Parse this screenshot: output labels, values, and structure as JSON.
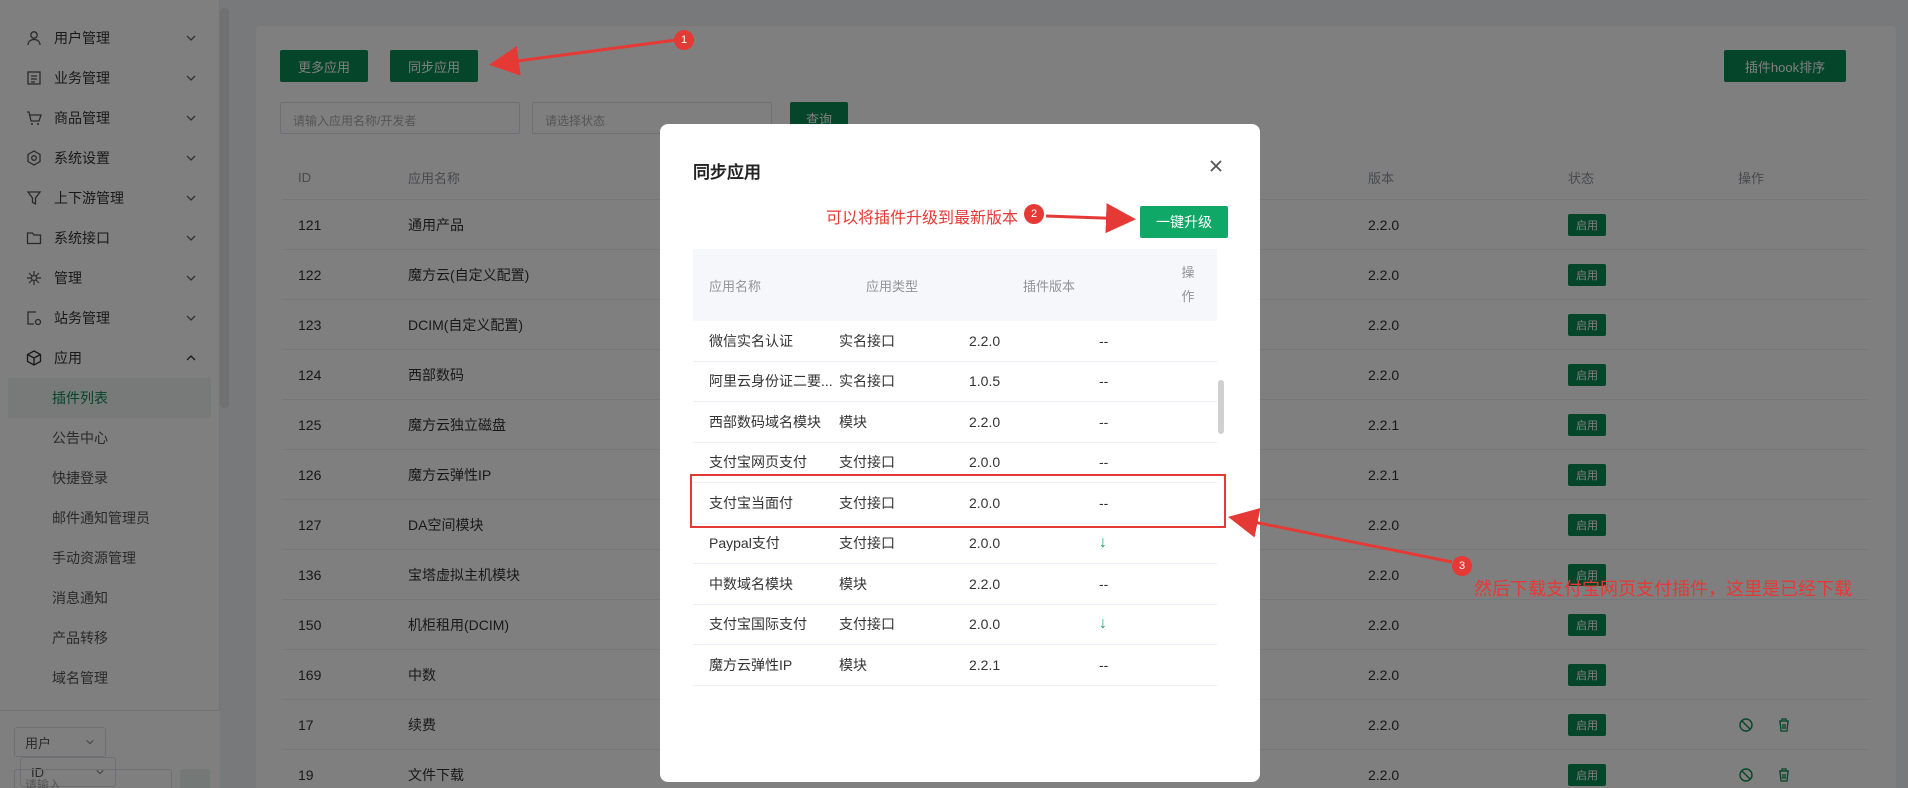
{
  "sidebar": {
    "menu_top": [
      {
        "label": "用户管理",
        "icon": "user-icon"
      },
      {
        "label": "业务管理",
        "icon": "list-icon"
      },
      {
        "label": "商品管理",
        "icon": "cart-icon"
      },
      {
        "label": "系统设置",
        "icon": "gear-icon"
      },
      {
        "label": "上下游管理",
        "icon": "filter-icon"
      },
      {
        "label": "系统接口",
        "icon": "folder-icon"
      },
      {
        "label": "管理",
        "icon": "sparkle-icon"
      },
      {
        "label": "站务管理",
        "icon": "station-icon"
      },
      {
        "label": "应用",
        "icon": "cube-icon"
      }
    ],
    "sub_items": [
      "插件列表",
      "公告中心",
      "快捷登录",
      "邮件通知管理员",
      "手动资源管理",
      "消息通知",
      "产品转移",
      "域名管理"
    ],
    "bottom": {
      "select1": "用户",
      "select2": "ID",
      "input_placeholder": "请输入"
    }
  },
  "toolbar": {
    "more_apps": "更多应用",
    "sync_apps": "同步应用",
    "hook_sort": "插件hook排序",
    "search_placeholder": "请输入应用名称/开发者",
    "status_placeholder": "请选择状态",
    "query": "查询"
  },
  "table": {
    "headers": {
      "id": "ID",
      "name": "应用名称",
      "version": "版本",
      "status": "状态",
      "action": "操作"
    },
    "rows": [
      {
        "id": "121",
        "name": "通用产品",
        "version": "2.2.0",
        "status": "启用"
      },
      {
        "id": "122",
        "name": "魔方云(自定义配置)",
        "version": "2.2.0",
        "status": "启用"
      },
      {
        "id": "123",
        "name": "DCIM(自定义配置)",
        "version": "2.2.0",
        "status": "启用"
      },
      {
        "id": "124",
        "name": "西部数码",
        "version": "2.2.0",
        "status": "启用"
      },
      {
        "id": "125",
        "name": "魔方云独立磁盘",
        "version": "2.2.1",
        "status": "启用"
      },
      {
        "id": "126",
        "name": "魔方云弹性IP",
        "version": "2.2.1",
        "status": "启用"
      },
      {
        "id": "127",
        "name": "DA空间模块",
        "version": "2.2.0",
        "status": "启用"
      },
      {
        "id": "136",
        "name": "宝塔虚拟主机模块",
        "version": "2.2.0",
        "status": "启用"
      },
      {
        "id": "150",
        "name": "机柜租用(DCIM)",
        "version": "2.2.0",
        "status": "启用"
      },
      {
        "id": "169",
        "name": "中数",
        "version": "2.2.0",
        "status": "启用"
      },
      {
        "id": "17",
        "name": "续费",
        "version": "2.2.0",
        "status": "启用"
      },
      {
        "id": "19",
        "name": "文件下载",
        "version": "2.2.0",
        "status": "启用"
      }
    ]
  },
  "modal": {
    "title": "同步应用",
    "upgrade_all": "一键升级",
    "headers": {
      "name": "应用名称",
      "type": "应用类型",
      "version": "插件版本",
      "action": "操作"
    },
    "rows": [
      {
        "name": "微信实名认证",
        "type": "实名接口",
        "version": "2.2.0",
        "action": "--"
      },
      {
        "name": "阿里云身份证二要...",
        "type": "实名接口",
        "version": "1.0.5",
        "action": "--"
      },
      {
        "name": "西部数码域名模块",
        "type": "模块",
        "version": "2.2.0",
        "action": "--"
      },
      {
        "name": "支付宝网页支付",
        "type": "支付接口",
        "version": "2.0.0",
        "action": "--"
      },
      {
        "name": "支付宝当面付",
        "type": "支付接口",
        "version": "2.0.0",
        "action": "--"
      },
      {
        "name": "Paypal支付",
        "type": "支付接口",
        "version": "2.0.0",
        "action": "↓"
      },
      {
        "name": "中数域名模块",
        "type": "模块",
        "version": "2.2.0",
        "action": "--"
      },
      {
        "name": "支付宝国际支付",
        "type": "支付接口",
        "version": "2.0.0",
        "action": "↓"
      },
      {
        "name": "魔方云弹性IP",
        "type": "模块",
        "version": "2.2.1",
        "action": "--"
      }
    ]
  },
  "annotations": {
    "num1": "1",
    "num2": "2",
    "num3": "3",
    "text2": "可以将插件升级到最新版本",
    "text3": "然后下载支付宝网页支付插件，这里是已经下载"
  },
  "colors": {
    "brand": "#0b8a55",
    "annotation": "#e53935"
  }
}
